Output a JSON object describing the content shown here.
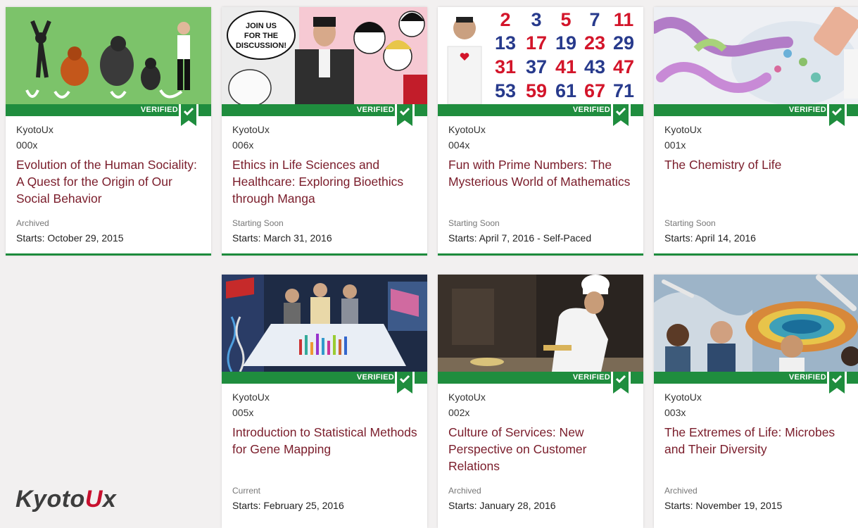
{
  "verified_label": "VERIFIED",
  "brand": {
    "part1": "Kyoto",
    "part2": "U",
    "part3": "x"
  },
  "courses": [
    {
      "org": "KyotoUx",
      "number": "000x",
      "title": "Evolution of the Human Sociality: A Quest for the Origin of Our Social Behavior",
      "status": "Archived",
      "starts": "Starts: October 29, 2015"
    },
    {
      "org": "KyotoUx",
      "number": "006x",
      "title": "Ethics in Life Sciences and Healthcare: Exploring Bioethics through Manga",
      "status": "Starting Soon",
      "starts": "Starts: March 31, 2016",
      "bubble": [
        "JOIN US",
        "FOR THE",
        "DISCUSSION!"
      ]
    },
    {
      "org": "KyotoUx",
      "number": "004x",
      "title": "Fun with Prime Numbers: The Mysterious World of Mathematics",
      "status": "Starting Soon",
      "starts": "Starts: April 7, 2016 - Self-Paced",
      "primes": [
        "2",
        "3",
        "5",
        "7",
        "11",
        "13",
        "17",
        "19",
        "23",
        "29",
        "31",
        "37",
        "41",
        "43",
        "47",
        "53",
        "59",
        "61",
        "67",
        "71"
      ]
    },
    {
      "org": "KyotoUx",
      "number": "001x",
      "title": "The Chemistry of Life",
      "status": "Starting Soon",
      "starts": "Starts: April 14, 2016"
    },
    {
      "org": "KyotoUx",
      "number": "005x",
      "title": "Introduction to Statistical Methods for Gene Mapping",
      "status": "Current",
      "starts": "Starts: February 25, 2016"
    },
    {
      "org": "KyotoUx",
      "number": "002x",
      "title": "Culture of Services: New Perspective on Customer Relations",
      "status": "Archived",
      "starts": "Starts: January 28, 2016"
    },
    {
      "org": "KyotoUx",
      "number": "003x",
      "title": "The Extremes of Life: Microbes and Their Diversity",
      "status": "Archived",
      "starts": "Starts: November 19, 2015"
    }
  ],
  "colors": {
    "accent": "#1f8d3e",
    "title": "#7a1c2a",
    "brand_u": "#c8102e"
  }
}
